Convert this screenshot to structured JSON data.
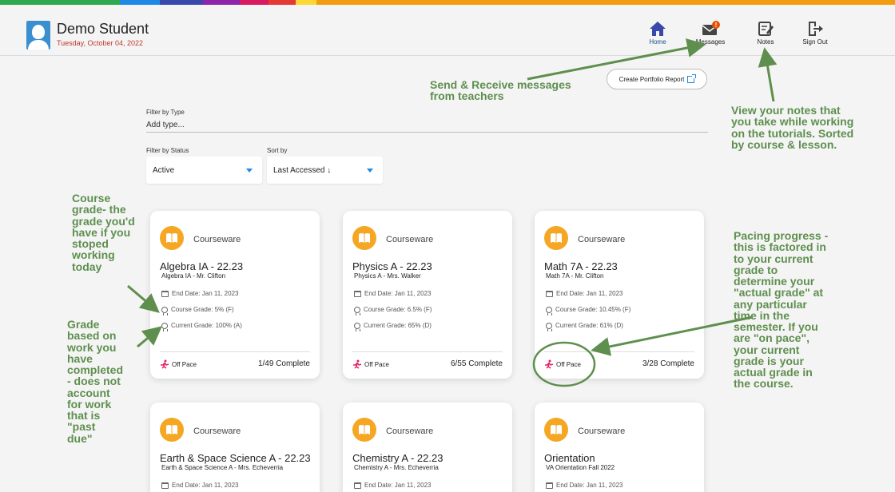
{
  "colors": {
    "rainbow": [
      "#2fa84f",
      "#2fa84f",
      "#1e88e5",
      "#3949ab",
      "#8e24aa",
      "#d81b60",
      "#e53935",
      "#fdd835",
      "#f39c12"
    ],
    "accent": "#1e88e5",
    "course_badge": "#f5a623",
    "off_pace": "#e91e63",
    "annotation": "#5e8f4e",
    "date": "#c0392b"
  },
  "header": {
    "user_name": "Demo Student",
    "date": "Tuesday, October 04, 2022",
    "nav": [
      {
        "label": "Home",
        "icon": "home-icon"
      },
      {
        "label": "Messages",
        "icon": "mail-icon",
        "badge": "!"
      },
      {
        "label": "Notes",
        "icon": "notes-icon"
      },
      {
        "label": "Sign Out",
        "icon": "signout-icon"
      }
    ]
  },
  "portfolio_button": "Create Portfolio Report",
  "filters": {
    "type_label": "Filter by Type",
    "type_placeholder": "Add type...",
    "status_label": "Filter by Status",
    "status_value": "Active",
    "sort_label": "Sort by",
    "sort_value": "Last Accessed ↓"
  },
  "courses": [
    {
      "type": "Courseware",
      "title": "Algebra IA - 22.23",
      "subtitle": "Algebra IA - Mr. Clifton",
      "end_date": "End Date: Jan 11, 2023",
      "course_grade": "Course Grade: 5% (F)",
      "current_grade": "Current Grade: 100% (A)",
      "pace": "Off Pace",
      "complete": "1/49 Complete"
    },
    {
      "type": "Courseware",
      "title": "Physics A - 22.23",
      "subtitle": "Physics A - Mrs. Walker",
      "end_date": "End Date: Jan 11, 2023",
      "course_grade": "Course Grade: 6.5% (F)",
      "current_grade": "Current Grade: 65% (D)",
      "pace": "Off Pace",
      "complete": "6/55 Complete"
    },
    {
      "type": "Courseware",
      "title": "Math 7A - 22.23",
      "subtitle": "Math 7A - Mr. Clifton",
      "end_date": "End Date: Jan 11, 2023",
      "course_grade": "Course Grade: 10.45% (F)",
      "current_grade": "Current Grade: 61% (D)",
      "pace": "Off Pace",
      "complete": "3/28 Complete"
    },
    {
      "type": "Courseware",
      "title": "Earth & Space Science A - 22.23",
      "subtitle": "Earth & Space Science A - Mrs. Echeverria",
      "end_date": "End Date: Jan 11, 2023"
    },
    {
      "type": "Courseware",
      "title": "Chemistry A - 22.23",
      "subtitle": "Chemistry A - Mrs. Echeverria",
      "end_date": "End Date: Jan 11, 2023"
    },
    {
      "type": "Courseware",
      "title": "Orientation",
      "subtitle": "VA Orientation Fall 2022",
      "end_date": "End Date: Jan 11, 2023"
    }
  ],
  "annotations": {
    "messages": [
      "Send & Receive messages",
      "from teachers"
    ],
    "notes": [
      "View your notes that",
      "you take while working",
      "on the tutorials. Sorted",
      "by course & lesson."
    ],
    "course_grade": [
      "Course",
      "grade- the",
      "grade you'd",
      "have if you",
      "stoped",
      "working",
      "today"
    ],
    "current_grade": [
      "Grade",
      "based on",
      "work you",
      "have",
      "completed",
      "- does not",
      "account",
      "for work",
      "that is",
      "\"past",
      "due\""
    ],
    "pacing": [
      "Pacing progress -",
      "this is factored in",
      "to your current",
      "grade to",
      "determine your",
      "\"actual grade\" at",
      "any particular",
      "time in the",
      "semester. If you",
      "are \"on pace\",",
      "your current",
      "grade is your",
      "actual grade in",
      "the course."
    ]
  }
}
